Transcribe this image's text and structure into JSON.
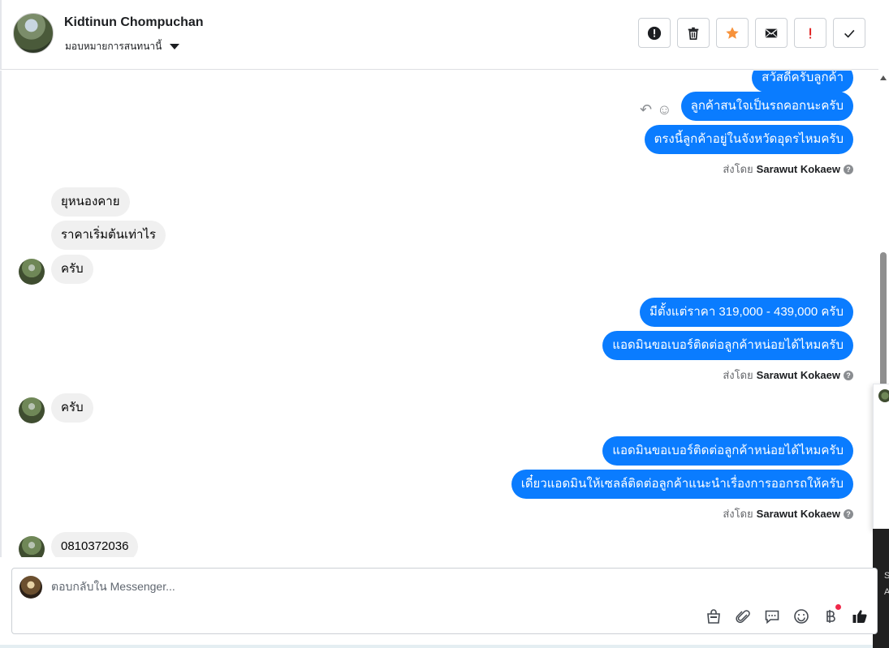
{
  "header": {
    "contact_name": "Kidtinun Chompuchan",
    "assign_label": "มอบหมายการสนทนานี้",
    "actions": [
      {
        "name": "spam-button",
        "icon": "exclamation-circle-icon"
      },
      {
        "name": "delete-button",
        "icon": "trash-icon"
      },
      {
        "name": "star-button",
        "icon": "star-icon",
        "color": "#f7923b"
      },
      {
        "name": "mark-unread-button",
        "icon": "envelope-icon"
      },
      {
        "name": "follow-up-button",
        "icon": "exclamation-icon",
        "color": "#e02020"
      },
      {
        "name": "mark-done-button",
        "icon": "check-icon"
      }
    ]
  },
  "messages": {
    "m1": "สวัสดีครับลูกค้า",
    "m2": "ลูกค้าสนใจเป็นรถคอกนะครับ",
    "m3": "ตรงนี้ลูกค้าอยู่ในจังหวัดอุดรไหมครับ",
    "sent_by_1": "Sarawut Kokaew",
    "in1": "ยุหนองคาย",
    "in2": "ราคาเริ่มต้นเท่าไร",
    "in3": "ครับ",
    "m4": "มีตั้งแต่ราคา 319,000 - 439,000 ครับ",
    "m5": "แอดมินขอเบอร์ติดต่อลูกค้าหน่อยได้ไหมครับ",
    "sent_by_2": "Sarawut Kokaew",
    "in4": "ครับ",
    "m6": "แอดมินขอเบอร์ติดต่อลูกค้าหน่อยได้ไหมครับ",
    "m7": "เดี๋ยวแอดมินให้เซลล์ติดต่อลูกค้าแนะนำเรื่องการออกรถให้ครับ",
    "sent_by_3": "Sarawut Kokaew",
    "in5": "0810372036",
    "sent_by_prefix": "ส่งโดย"
  },
  "composer": {
    "placeholder": "ตอบกลับใน Messenger...",
    "tools": [
      "shop-icon",
      "attachment-icon",
      "saved-reply-icon",
      "emoji-icon",
      "baht-payment-icon",
      "thumbs-up-icon"
    ]
  },
  "side_widget": {
    "dark_lines": [
      "S",
      "A"
    ]
  }
}
